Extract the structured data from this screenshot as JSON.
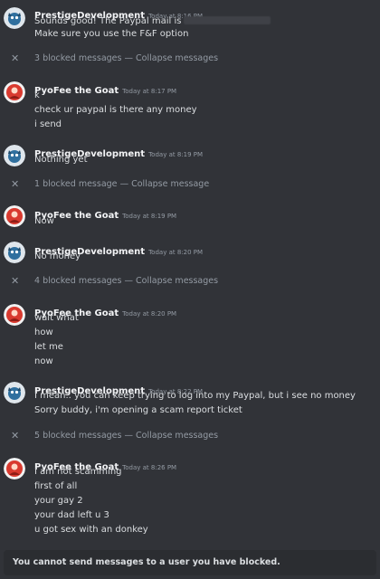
{
  "users": {
    "prestige": {
      "name": "PrestigeDevelopment",
      "avatar_icon": "dog-avatar-icon",
      "color": "#2f6f9e"
    },
    "pyofee": {
      "name": "PyoFee the Goat",
      "avatar_icon": "red-avatar-icon",
      "color": "#d93a2f"
    }
  },
  "messages": [
    {
      "ts": "Today at 8:16 PM",
      "lines": [
        "Sounds good! The Paypal mail is",
        "Make sure you use the F&F option"
      ]
    },
    {
      "blocked": "3 blocked messages",
      "sep": "—",
      "collapse": "Collapse messages"
    },
    {
      "ts": "Today at 8:17 PM",
      "lines": [
        "k",
        "check ur paypal is there any money",
        "i send"
      ]
    },
    {
      "ts": "Today at 8:19 PM",
      "lines": [
        "Nothing yet"
      ]
    },
    {
      "blocked": "1 blocked message",
      "sep": "—",
      "collapse": "Collapse message"
    },
    {
      "ts": "Today at 8:19 PM",
      "lines": [
        "Now"
      ]
    },
    {
      "ts": "Today at 8:20 PM",
      "lines": [
        "No money"
      ]
    },
    {
      "blocked": "4 blocked messages",
      "sep": "—",
      "collapse": "Collapse messages"
    },
    {
      "ts": "Today at 8:20 PM",
      "lines": [
        "wait what",
        "how",
        "let me",
        "now"
      ]
    },
    {
      "ts": "Today at 8:22 PM",
      "lines": [
        "I mean.. you can keep trying to log into my Paypal, but i see no money",
        "Sorry buddy, i'm opening a scam report ticket"
      ]
    },
    {
      "blocked": "5 blocked messages",
      "sep": "—",
      "collapse": "Collapse messages"
    },
    {
      "ts": "Today at 8:26 PM",
      "lines": [
        "I am not scamming",
        "first of all",
        "your gay 2",
        "your dad left u 3",
        "u got sex with an donkey"
      ]
    }
  ],
  "footer": {
    "text": "You cannot send messages to a user you have blocked."
  }
}
